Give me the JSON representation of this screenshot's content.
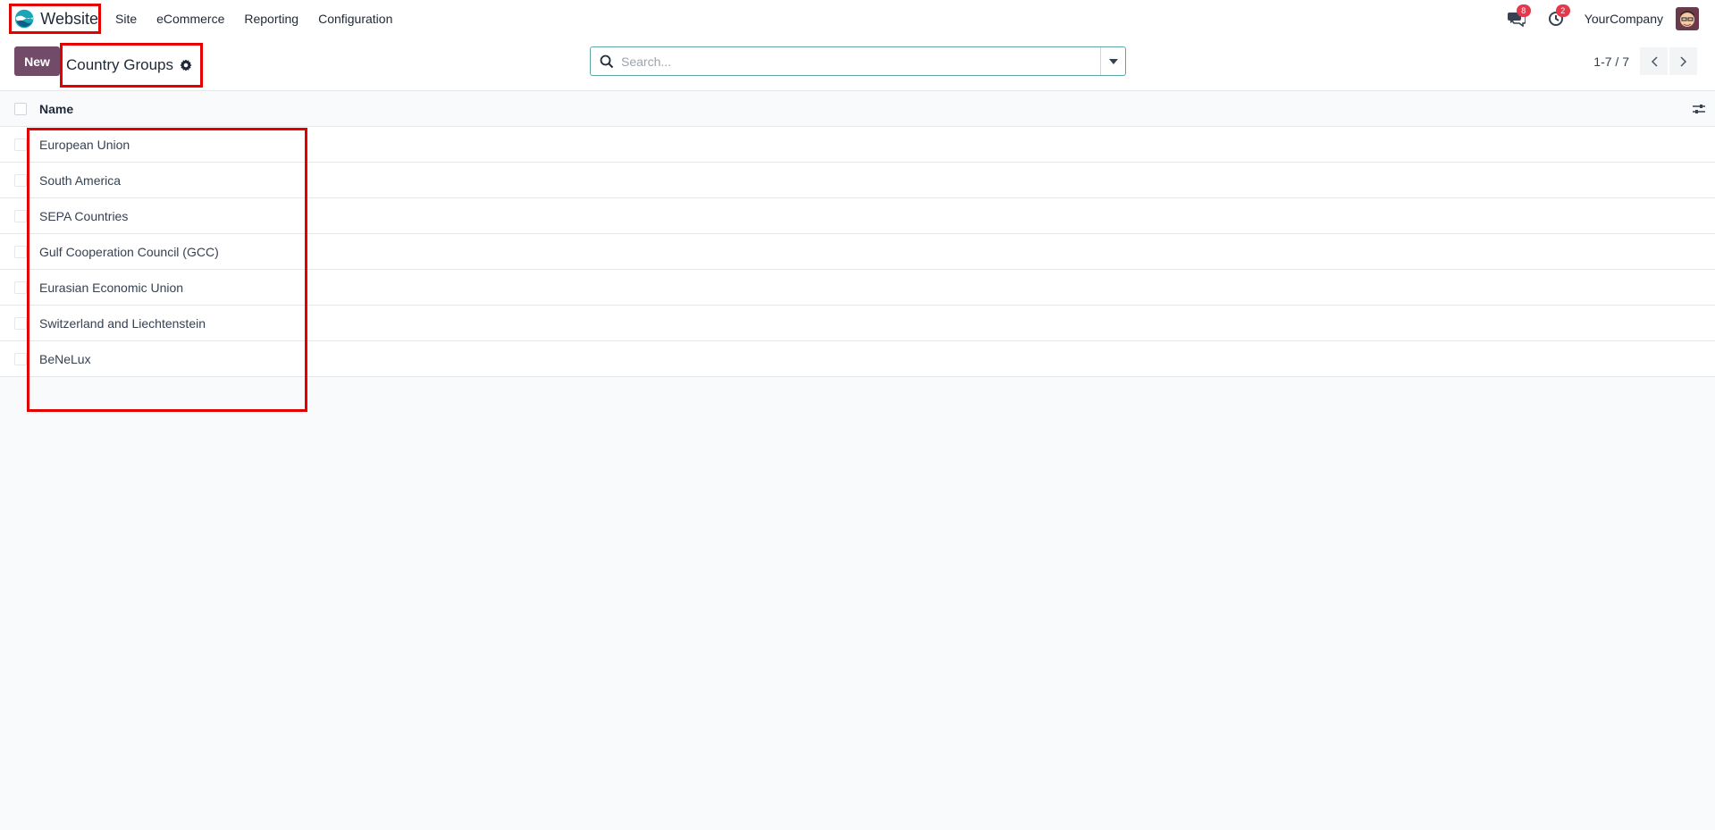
{
  "navbar": {
    "app_name": "Website",
    "menu": [
      "Site",
      "eCommerce",
      "Reporting",
      "Configuration"
    ],
    "messages_count": "8",
    "activities_count": "2",
    "company": "YourCompany"
  },
  "control_panel": {
    "new_label": "New",
    "title": "Country Groups",
    "search_placeholder": "Search...",
    "pager_value": "1-7 / 7"
  },
  "list": {
    "column_header": "Name",
    "rows": [
      "European Union",
      "South America",
      "SEPA Countries",
      "Gulf Cooperation Council (GCC)",
      "Eurasian Economic Union",
      "Switzerland and Liechtenstein",
      "BeNeLux"
    ]
  },
  "colors": {
    "brand_primary": "#714b67",
    "highlight_border": "#e50000",
    "badge": "#e4394d",
    "search_focus": "#5fa6a7"
  },
  "icons": [
    "website-logo-icon",
    "chat-icon",
    "clock-icon",
    "gear-icon",
    "search-icon",
    "caret-down-icon",
    "chevron-left-icon",
    "chevron-right-icon",
    "optional-columns-icon"
  ]
}
